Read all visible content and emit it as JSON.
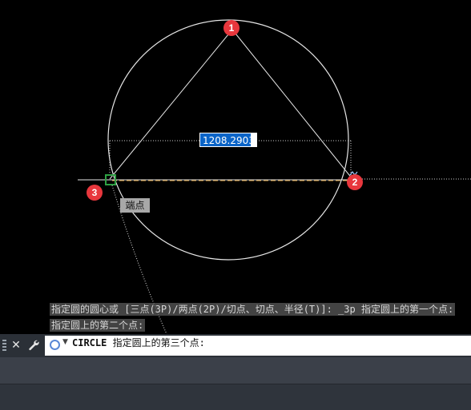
{
  "drawing": {
    "dimension_value": "1208.2903",
    "snap_tooltip": "端点",
    "markers": [
      "1",
      "2",
      "3"
    ]
  },
  "command_history": [
    "指定圆的圆心或 [三点(3P)/两点(2P)/切点、切点、半径(T)]: _3p 指定圆上的第一个点:",
    "指定圆上的第二个点:"
  ],
  "command_line": {
    "command": "CIRCLE",
    "prompt": "指定圆上的第三个点:",
    "close_label": "✕",
    "customize_label": "🔧"
  },
  "colors": {
    "background": "#000000",
    "geometry": "#ffffff",
    "marker": "#e8373d",
    "input_highlight": "#0a64c8",
    "snap_marker": "#2ea043"
  }
}
